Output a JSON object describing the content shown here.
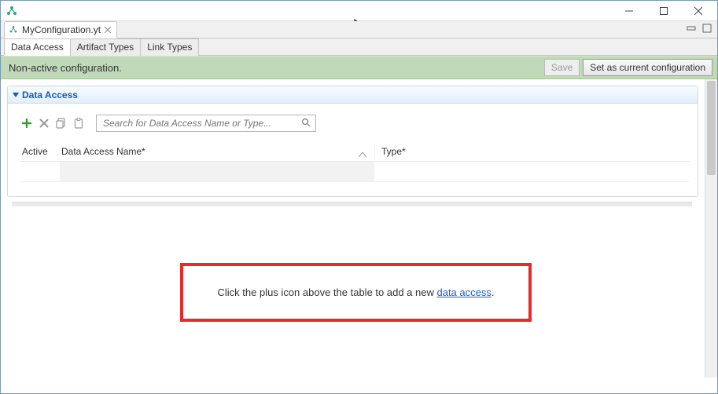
{
  "editor_tab": {
    "label": "MyConfiguration.yt"
  },
  "sub_tabs": [
    {
      "label": "Data Access",
      "active": true
    },
    {
      "label": "Artifact Types",
      "active": false
    },
    {
      "label": "Link Types",
      "active": false
    }
  ],
  "status": {
    "message": "Non-active configuration.",
    "save_label": "Save",
    "set_current_label": "Set as current configuration"
  },
  "section": {
    "title": "Data Access",
    "search_placeholder": "Search for Data Access Name or Type...",
    "columns": {
      "active": "Active",
      "name": "Data Access Name*",
      "type": "Type*"
    }
  },
  "callout": {
    "prefix": "Click the plus icon above the table to add a new ",
    "link_text": "data access",
    "suffix": "."
  }
}
